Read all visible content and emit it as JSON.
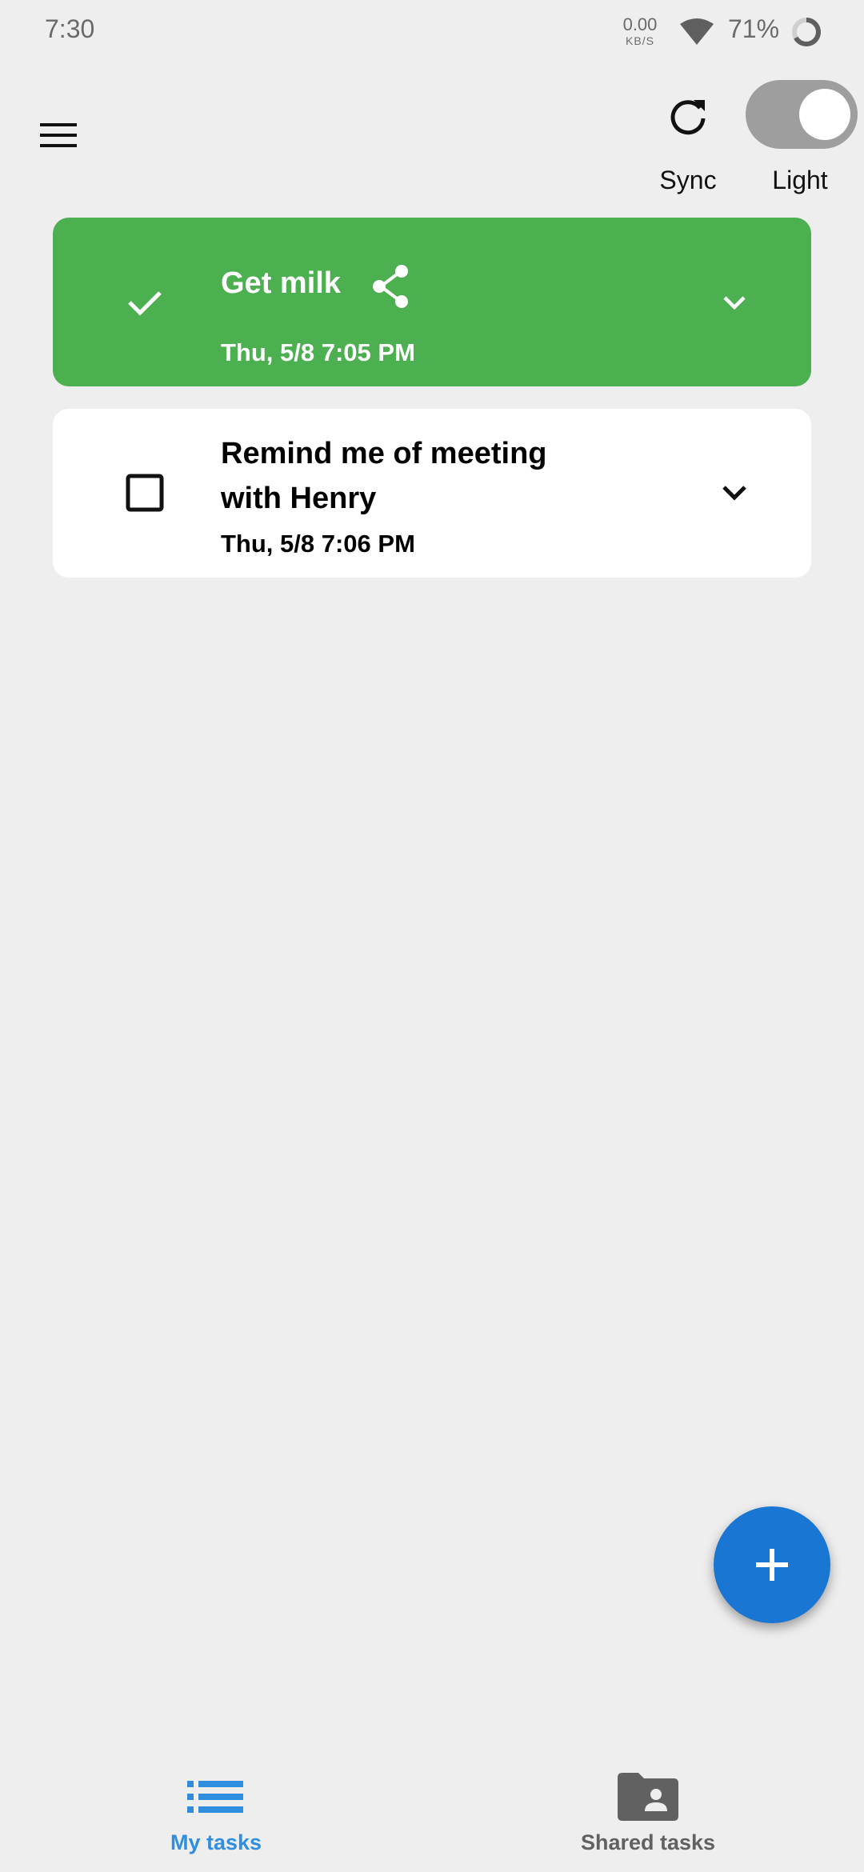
{
  "status_bar": {
    "time": "7:30",
    "net_speed_value": "0.00",
    "net_speed_unit": "KB/S",
    "battery": "71%",
    "icons": [
      "wifi-icon",
      "battery-ring-icon"
    ]
  },
  "toolbar": {
    "menu_icon": "hamburger-menu-icon",
    "sync_icon": "refresh-icon",
    "sync_label": "Sync",
    "theme_toggle_on": true,
    "theme_label": "Light"
  },
  "tasks": [
    {
      "title": "Get milk",
      "date": "Thu, 5/8 7:05 PM",
      "completed": true,
      "background": "#4caf50",
      "icons": [
        "check-icon",
        "share-icon",
        "chevron-down-icon"
      ]
    },
    {
      "title": "Remind me of meeting with Henry",
      "date": "Thu, 5/8 7:06 PM",
      "completed": false,
      "background": "#ffffff",
      "icons": [
        "checkbox-icon",
        "chevron-down-icon"
      ]
    }
  ],
  "fab": {
    "icon": "plus-icon",
    "color": "#1976d2"
  },
  "bottom_nav": {
    "items": [
      {
        "label": "My tasks",
        "icon": "list-icon",
        "active": true,
        "color": "#2f8fde"
      },
      {
        "label": "Shared tasks",
        "icon": "shared-folder-icon",
        "active": false,
        "color": "#616161"
      }
    ]
  }
}
